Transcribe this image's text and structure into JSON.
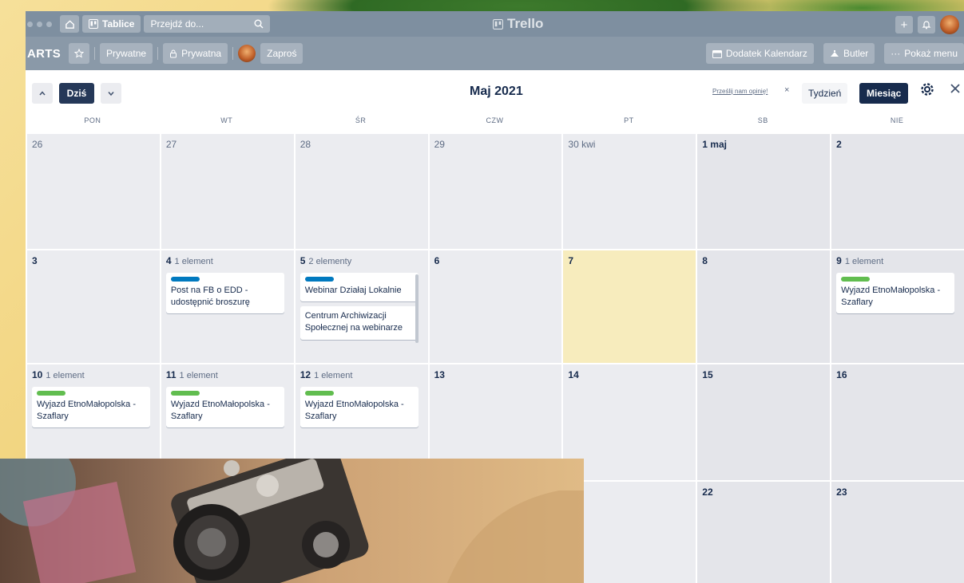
{
  "topbar": {
    "boards_label": "Tablice",
    "search_placeholder": "Przejdź do...",
    "app_name": "Trello"
  },
  "board": {
    "title": "ARTS",
    "visibility_label": "Prywatne",
    "privacy_label": "Prywatna",
    "invite_label": "Zaproś",
    "calendar_addon_label": "Dodatek Kalendarz",
    "butler_label": "Butler",
    "show_menu_label": "Pokaż menu"
  },
  "calendar": {
    "today_label": "Dziś",
    "month_title": "Maj 2021",
    "feedback_label": "Prześlij nam opinię!",
    "week_label": "Tydzień",
    "month_label": "Miesiąc",
    "weekdays": [
      "PON",
      "WT",
      "ŚR",
      "CZW",
      "PT",
      "SB",
      "NIE"
    ],
    "label_colors": {
      "blue": "#0079bf",
      "green": "#61bd4f"
    },
    "weeks": [
      [
        {
          "day": "26",
          "count": "",
          "cards": []
        },
        {
          "day": "27",
          "count": "",
          "cards": []
        },
        {
          "day": "28",
          "count": "",
          "cards": []
        },
        {
          "day": "29",
          "count": "",
          "cards": []
        },
        {
          "day": "30 kwi",
          "count": "",
          "cards": []
        },
        {
          "day": "1 maj",
          "count": "",
          "cards": []
        },
        {
          "day": "2",
          "count": "",
          "cards": []
        }
      ],
      [
        {
          "day": "3",
          "count": "",
          "cards": []
        },
        {
          "day": "4",
          "count": "1 element",
          "cards": [
            {
              "label": "blue",
              "text": "Post na FB o EDD - udostępnić broszurę"
            }
          ]
        },
        {
          "day": "5",
          "count": "2 elementy",
          "cards": [
            {
              "label": "blue",
              "text": "Webinar Działaj Lokalnie"
            },
            {
              "label": "",
              "text": "Centrum Archiwizacji Społecznej na webinarze"
            }
          ]
        },
        {
          "day": "6",
          "count": "",
          "cards": []
        },
        {
          "day": "7",
          "count": "",
          "cards": []
        },
        {
          "day": "8",
          "count": "",
          "cards": []
        },
        {
          "day": "9",
          "count": "1 element",
          "cards": [
            {
              "label": "green",
              "text": "Wyjazd EtnoMałopolska - Szaflary"
            }
          ]
        }
      ],
      [
        {
          "day": "10",
          "count": "1 element",
          "cards": [
            {
              "label": "green",
              "text": "Wyjazd EtnoMałopolska - Szaflary"
            }
          ]
        },
        {
          "day": "11",
          "count": "1 element",
          "cards": [
            {
              "label": "green",
              "text": "Wyjazd EtnoMałopolska - Szaflary"
            }
          ]
        },
        {
          "day": "12",
          "count": "1 element",
          "cards": [
            {
              "label": "green",
              "text": "Wyjazd EtnoMałopolska - Szaflary"
            }
          ]
        },
        {
          "day": "13",
          "count": "",
          "cards": []
        },
        {
          "day": "14",
          "count": "",
          "cards": []
        },
        {
          "day": "15",
          "count": "",
          "cards": []
        },
        {
          "day": "16",
          "count": "",
          "cards": []
        }
      ],
      [
        {
          "day": "",
          "count": "",
          "cards": []
        },
        {
          "day": "",
          "count": "",
          "cards": []
        },
        {
          "day": "",
          "count": "",
          "cards": []
        },
        {
          "day": "",
          "count": "",
          "cards": []
        },
        {
          "day": "",
          "count": "",
          "cards": []
        },
        {
          "day": "22",
          "count": "",
          "cards": []
        },
        {
          "day": "23",
          "count": "",
          "cards": []
        }
      ]
    ]
  }
}
